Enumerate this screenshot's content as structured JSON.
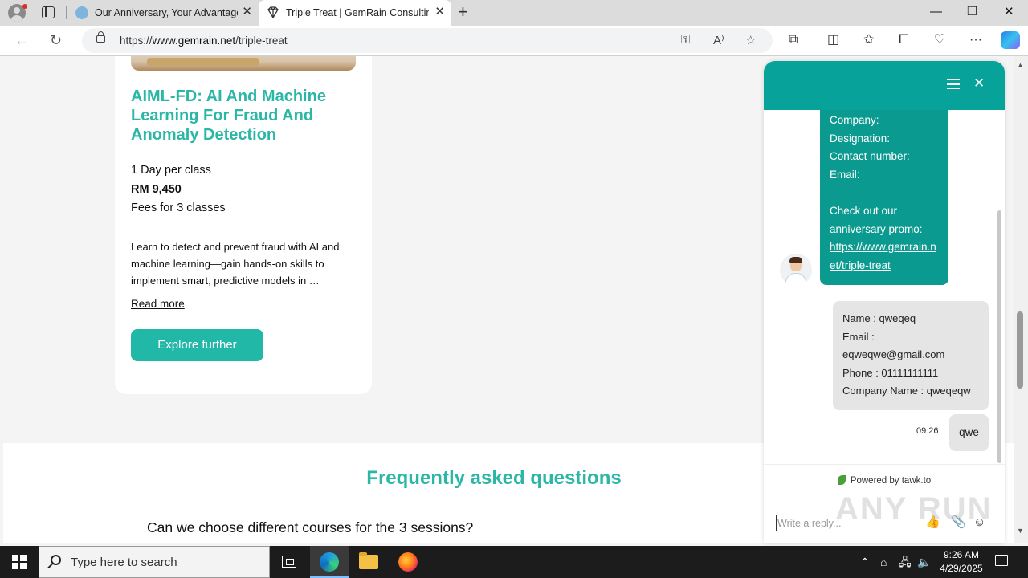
{
  "browser": {
    "tabs": [
      {
        "title": "Our Anniversary, Your Advantage",
        "active": false
      },
      {
        "title": "Triple Treat | GemRain Consulting",
        "active": true
      }
    ],
    "url_prefix": "https://",
    "url_host": "www.gemrain.net",
    "url_path": "/triple-treat"
  },
  "course": {
    "title": "AIML-FD: AI And Machine Learning For Fraud And Anomaly Detection",
    "duration": "1 Day per class",
    "price": "RM 9,450",
    "fees_note": "Fees for 3 classes",
    "description": "Learn to detect and prevent fraud with AI and machine learning—gain hands-on skills to implement smart, predictive models in …",
    "read_more": "Read more",
    "cta": "Explore further"
  },
  "faq": {
    "title": "Frequently asked questions",
    "first_question": "Can we choose different courses for the 3 sessions?"
  },
  "chat": {
    "agent_message_lines": [
      "Company:",
      "Designation:",
      "Contact number:",
      "Email:",
      "",
      "Check out our anniversary promo:"
    ],
    "agent_link": "https://www.gemrain.net/triple-treat",
    "user_message_lines": [
      "Name : qweqeq",
      "Email :",
      "eqweqwe@gmail.com",
      "Phone : 01111111111",
      "Company Name : qweqeqw"
    ],
    "time": "09:26",
    "user_short_message": "qwe",
    "powered_by": "Powered by tawk.to",
    "reply_placeholder": "Write a reply..."
  },
  "taskbar": {
    "search_placeholder": "Type here to search",
    "time": "9:26 AM",
    "date": "4/29/2025"
  },
  "watermark": "ANY RUN",
  "colors": {
    "brand_teal": "#2bb7a6",
    "chat_teal": "#07a39a",
    "button_teal": "#22b8a7"
  }
}
